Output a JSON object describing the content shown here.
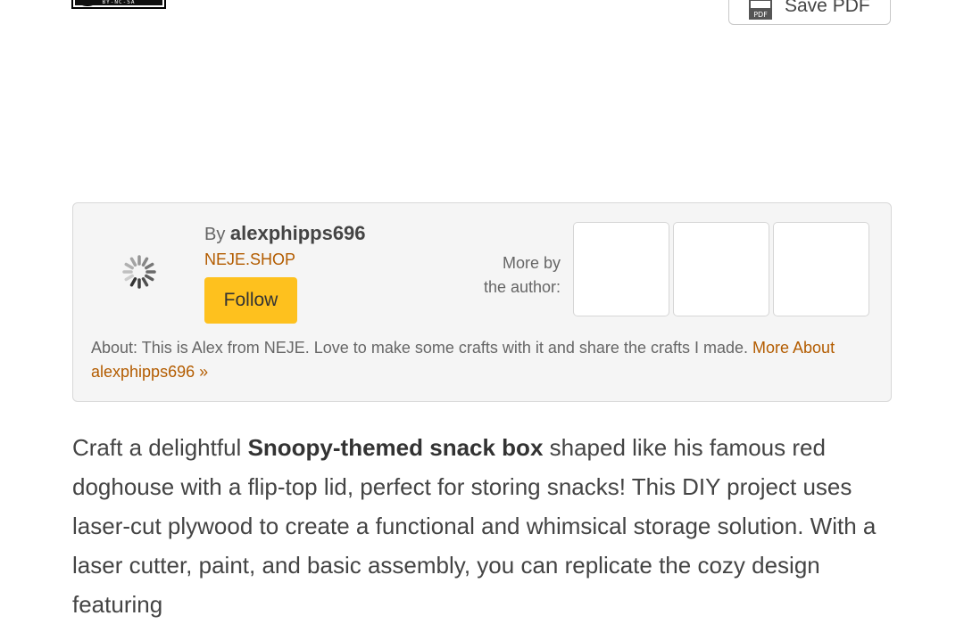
{
  "license": {
    "text": "BY-NC-SA"
  },
  "toolbar": {
    "save_pdf_label": "Save PDF",
    "pdf_icon": "pdf-icon"
  },
  "author": {
    "by_prefix": "By",
    "name": "alexphipps696",
    "shop": "NEJE.SHOP",
    "follow_label": "Follow",
    "more_by_line1": "More by",
    "more_by_line2": "the author:",
    "about_prefix": "About:",
    "about_text": "This is Alex from NEJE. Love to make some crafts with it and share the crafts I made.",
    "more_about_link": "More About alexphipps696 »"
  },
  "article": {
    "intro_1": "Craft a delightful ",
    "intro_bold": "Snoopy-themed snack box",
    "intro_2": " shaped like his famous red doghouse with a flip-top lid, perfect for storing snacks! This DIY project uses laser-cut plywood to create a functional and whimsical storage solution. With a laser cutter, paint, and basic assembly, you can replicate the cozy design featuring"
  },
  "colors": {
    "accent": "#fec11e",
    "link": "#b35c00",
    "panel_bg": "#f5f5f5"
  }
}
